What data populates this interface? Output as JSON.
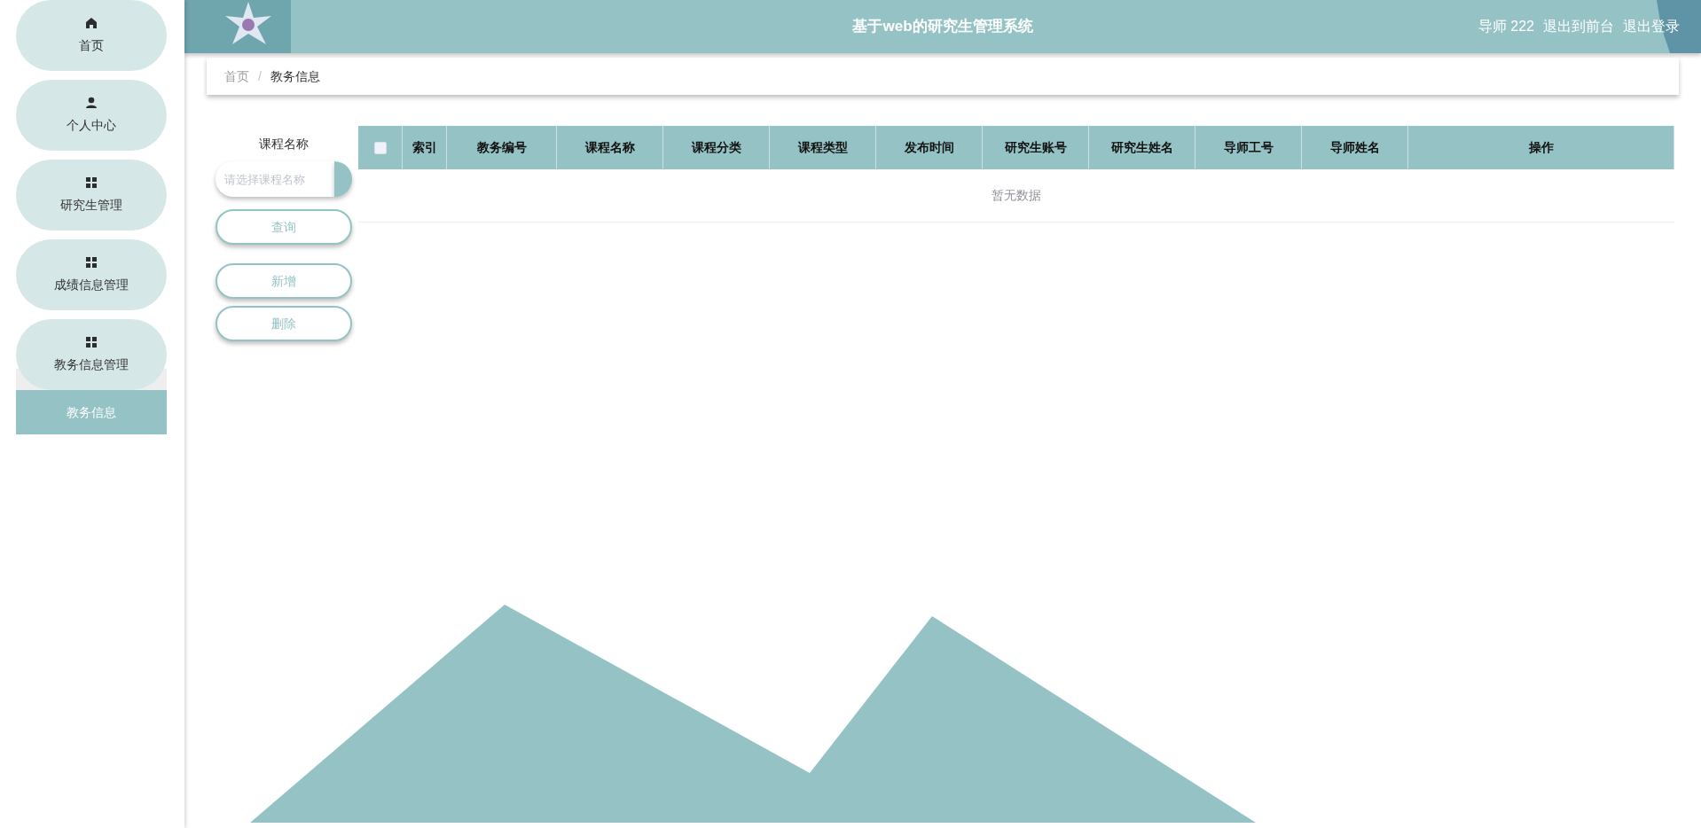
{
  "header": {
    "title": "基于web的研究生管理系统",
    "user": "导师 222",
    "links": [
      "退出到前台",
      "退出登录"
    ]
  },
  "sidebar": {
    "items": [
      {
        "label": "首页",
        "kind": "home",
        "selected": false
      },
      {
        "label": "个人中心",
        "kind": "user",
        "selected": false
      },
      {
        "label": "研究生管理",
        "kind": "group",
        "selected": false
      },
      {
        "label": "成绩信息管理",
        "kind": "group",
        "selected": false
      },
      {
        "label": "教务信息管理",
        "kind": "group",
        "selected": false,
        "expanded": true,
        "children": [
          {
            "label": "教务信息",
            "selected": true
          }
        ]
      }
    ]
  },
  "breadcrumb": {
    "separator": "/",
    "items": [
      "首页",
      "教务信息"
    ]
  },
  "filter": {
    "label": "课程名称",
    "select": {
      "placeholder": "请选择课程名称"
    },
    "buttons": [
      "查询",
      "新增",
      "删除"
    ]
  },
  "table": {
    "select_all": {
      "checked": false
    },
    "columns": [
      "索引",
      "教务编号",
      "课程名称",
      "课程分类",
      "课程类型",
      "发布时间",
      "研究生账号",
      "研究生姓名",
      "导师工号",
      "导师姓名",
      "操作"
    ],
    "empty_text": "暂无数据"
  }
}
